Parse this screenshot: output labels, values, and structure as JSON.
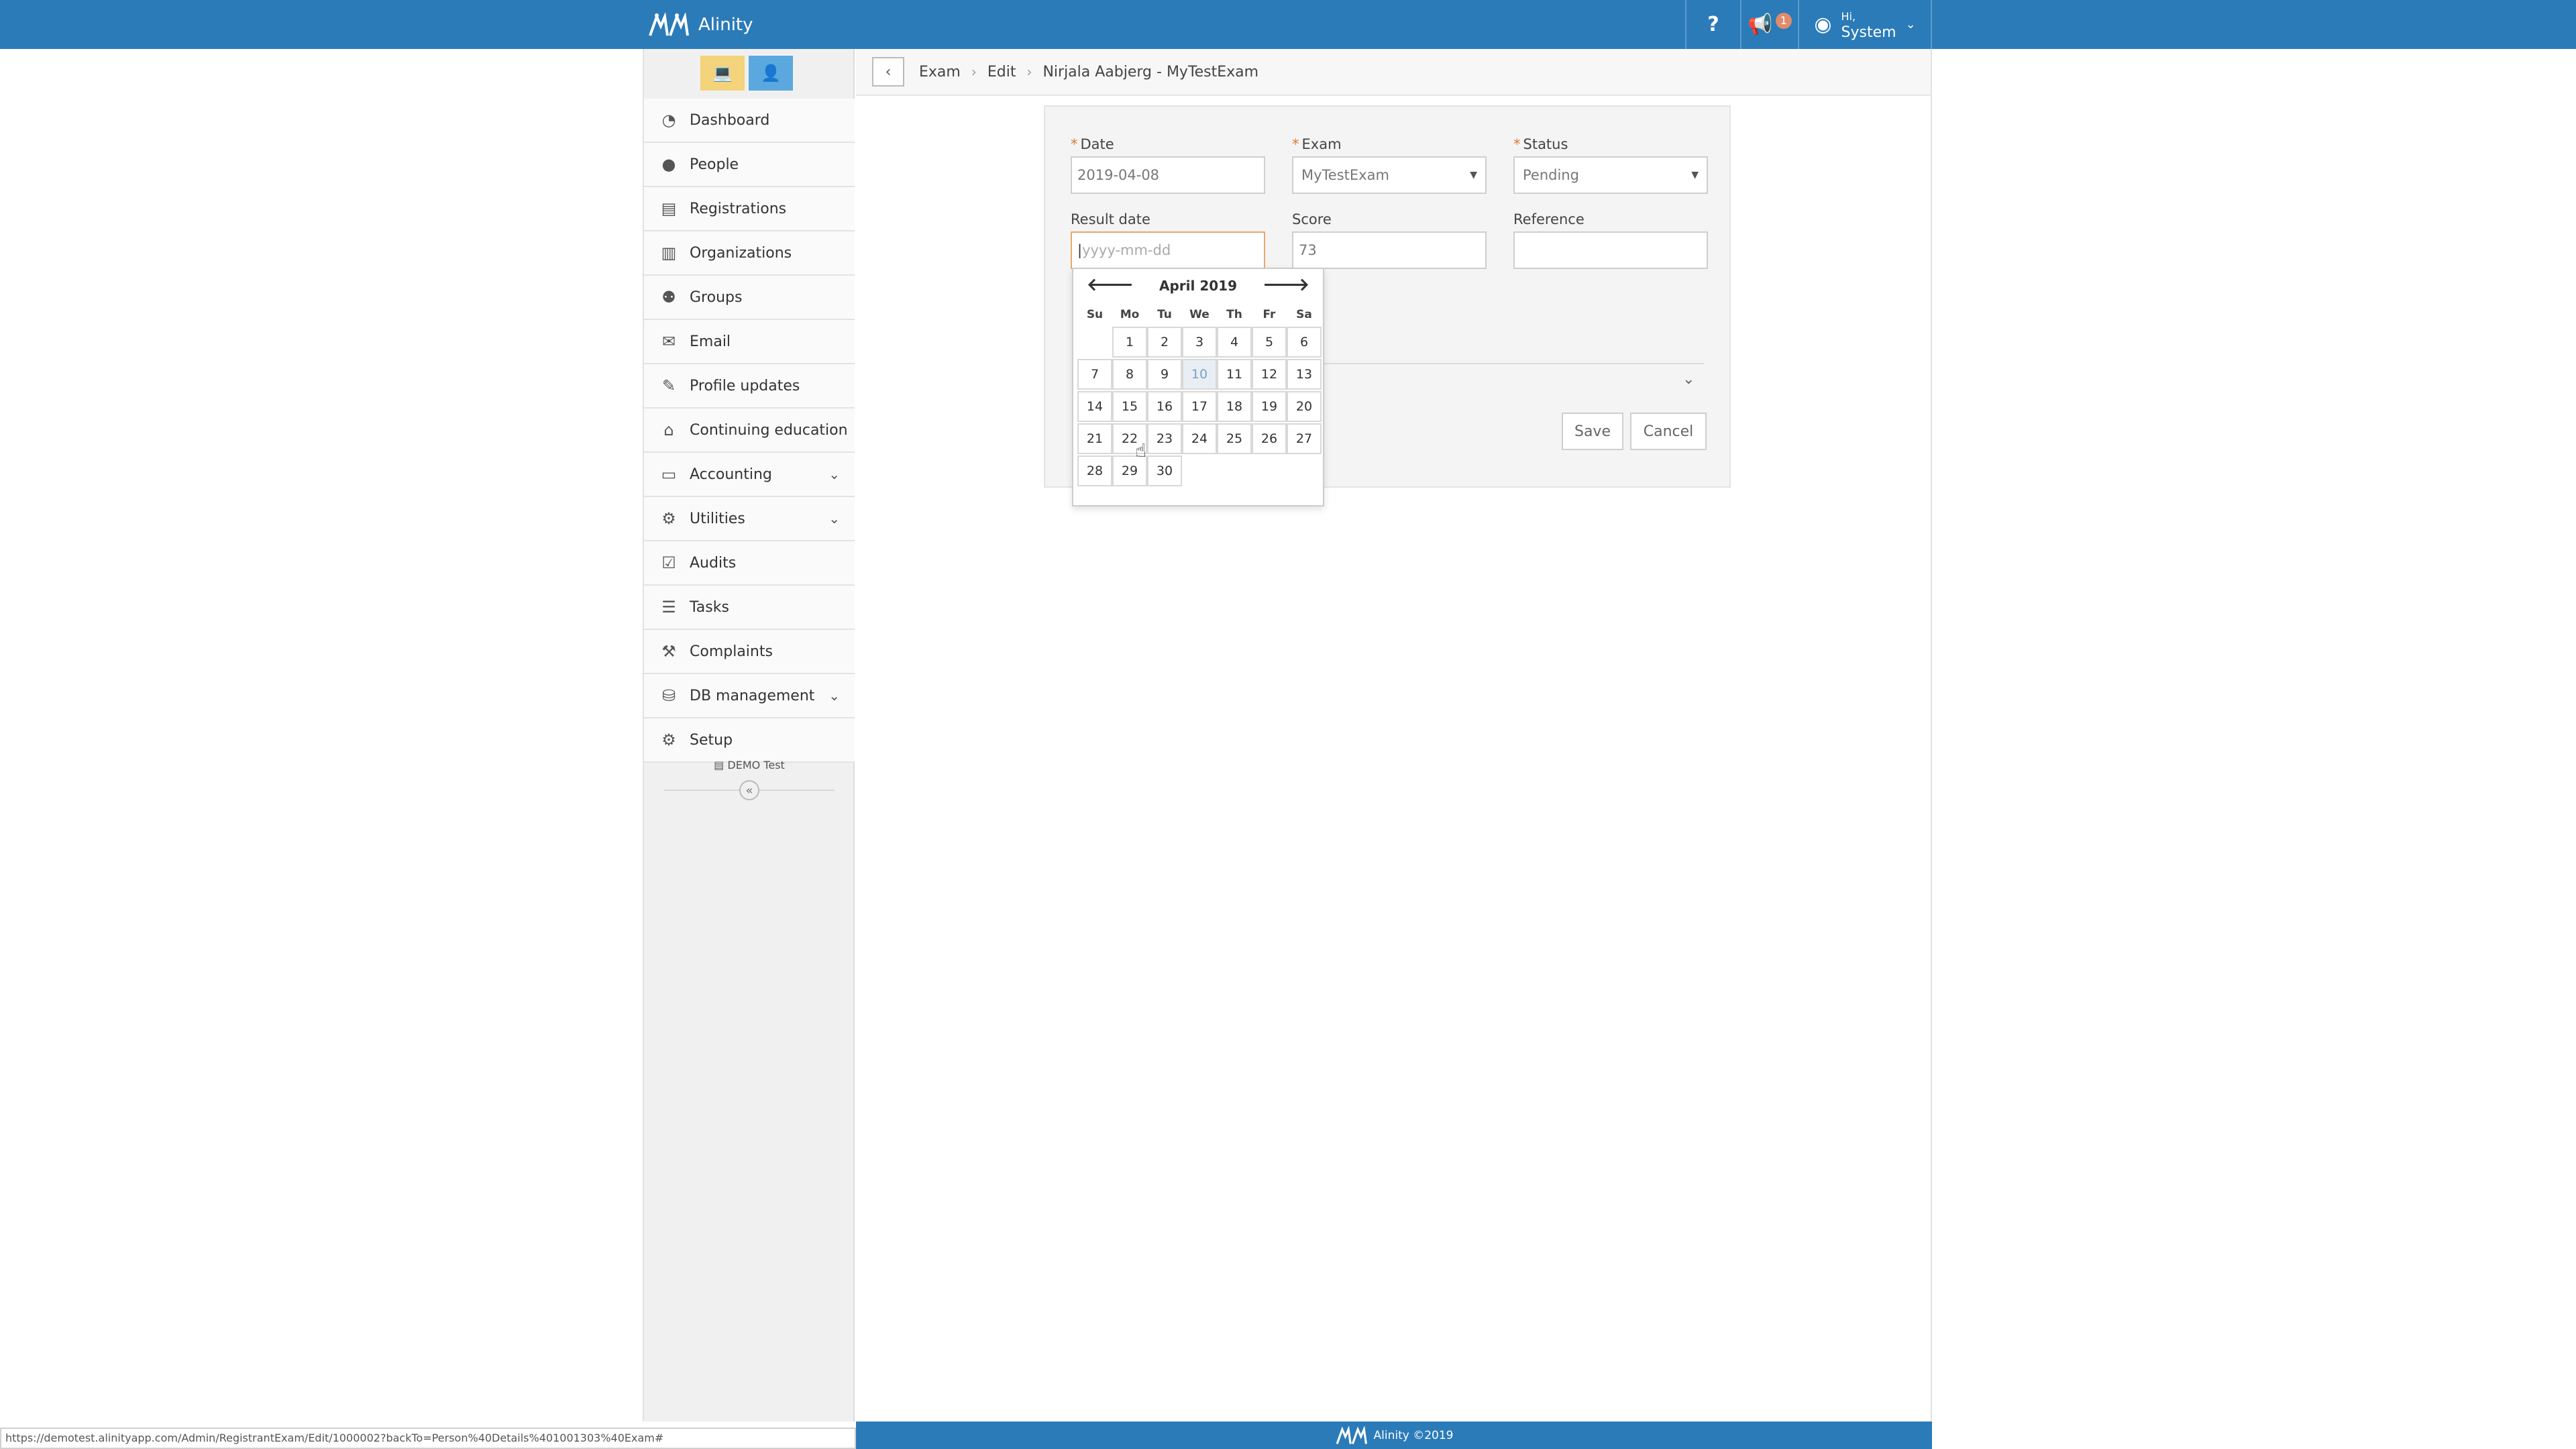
{
  "app": {
    "title": "Alinity"
  },
  "topbar": {
    "help_label": "?",
    "notification_count": "1",
    "user_greeting": "Hi,",
    "user_name": "System"
  },
  "sidebar": {
    "items": [
      {
        "label": "Dashboard",
        "icon": "dashboard-icon",
        "glyph": "◔"
      },
      {
        "label": "People",
        "icon": "person-icon",
        "glyph": "●"
      },
      {
        "label": "Registrations",
        "icon": "id-card-icon",
        "glyph": "▤"
      },
      {
        "label": "Organizations",
        "icon": "building-icon",
        "glyph": "▥"
      },
      {
        "label": "Groups",
        "icon": "users-icon",
        "glyph": "⚉"
      },
      {
        "label": "Email",
        "icon": "envelope-icon",
        "glyph": "✉"
      },
      {
        "label": "Profile updates",
        "icon": "edit-icon",
        "glyph": "✎"
      },
      {
        "label": "Continuing education",
        "icon": "graduation-cap-icon",
        "glyph": "⌂"
      },
      {
        "label": "Accounting",
        "icon": "money-icon",
        "glyph": "▭",
        "expandable": true
      },
      {
        "label": "Utilities",
        "icon": "cogs-icon",
        "glyph": "⚙",
        "expandable": true
      },
      {
        "label": "Audits",
        "icon": "checkbox-icon",
        "glyph": "☑"
      },
      {
        "label": "Tasks",
        "icon": "list-icon",
        "glyph": "☰"
      },
      {
        "label": "Complaints",
        "icon": "gavel-icon",
        "glyph": "⚒"
      },
      {
        "label": "DB management",
        "icon": "database-icon",
        "glyph": "⛁",
        "expandable": true
      },
      {
        "label": "Setup",
        "icon": "gear-icon",
        "glyph": "⚙"
      }
    ],
    "env_label": "DEMO Test"
  },
  "breadcrumb": {
    "items": [
      "Exam",
      "Edit",
      "Nirjala Aabjerg - MyTestExam"
    ]
  },
  "form": {
    "date": {
      "label": "Date",
      "value": "2019-04-08",
      "required": true
    },
    "exam": {
      "label": "Exam",
      "value": "MyTestExam",
      "required": true
    },
    "status": {
      "label": "Status",
      "value": "Pending",
      "required": true
    },
    "result_date": {
      "label": "Result date",
      "value": "",
      "placeholder": "yyyy-mm-dd"
    },
    "score": {
      "label": "Score",
      "value": "73"
    },
    "reference": {
      "label": "Reference",
      "value": ""
    },
    "save_label": "Save",
    "cancel_label": "Cancel"
  },
  "datepicker": {
    "month_label": "April 2019",
    "weekdays": [
      "Su",
      "Mo",
      "Tu",
      "We",
      "Th",
      "Fr",
      "Sa"
    ],
    "weeks": [
      [
        "",
        "1",
        "2",
        "3",
        "4",
        "5",
        "6"
      ],
      [
        "7",
        "8",
        "9",
        "10",
        "11",
        "12",
        "13"
      ],
      [
        "14",
        "15",
        "16",
        "17",
        "18",
        "19",
        "20"
      ],
      [
        "21",
        "22",
        "23",
        "24",
        "25",
        "26",
        "27"
      ],
      [
        "28",
        "29",
        "30",
        "",
        "",
        "",
        ""
      ]
    ],
    "hovered_day": "10"
  },
  "footer": {
    "copyright": "Alinity ©2019",
    "status_url": "https://demotest.alinityapp.com/Admin/RegistrantExam/Edit/1000002?backTo=Person%40Details%401001303%40Exam#"
  },
  "colors": {
    "primary": "#2b7bb9",
    "required": "#e07a2d",
    "focus_border": "#e8a86a"
  }
}
